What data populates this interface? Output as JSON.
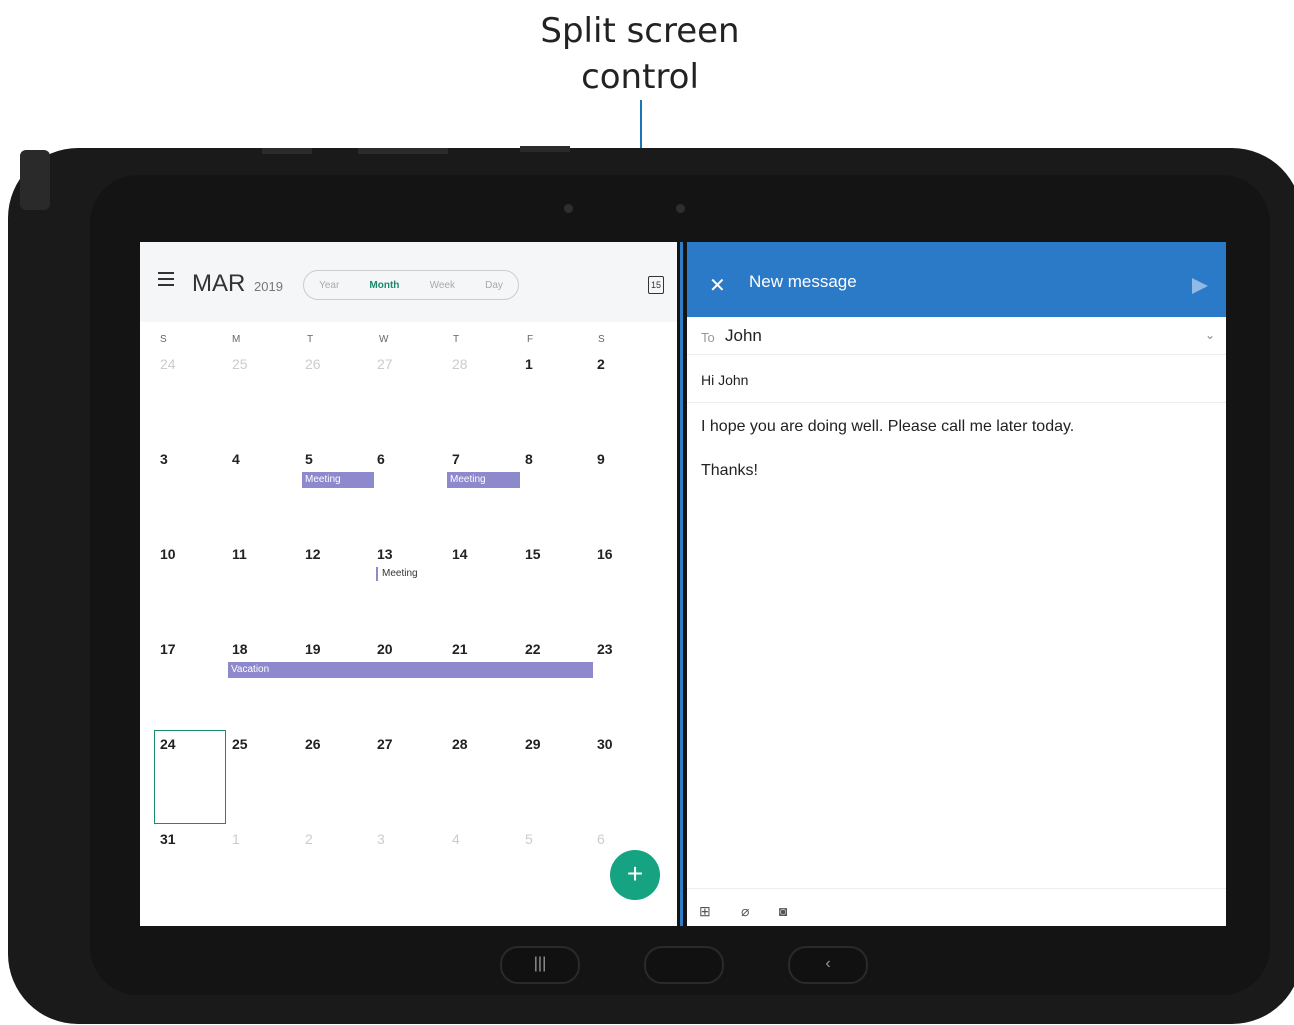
{
  "callout": {
    "line1": "Split screen",
    "line2": "control"
  },
  "calendar": {
    "month": "MAR",
    "year": "2019",
    "tabs": [
      {
        "label": "Year",
        "active": false
      },
      {
        "label": "Month",
        "active": true
      },
      {
        "label": "Week",
        "active": false
      },
      {
        "label": "Day",
        "active": false
      }
    ],
    "today_icon": "15",
    "weekdays": [
      "S",
      "M",
      "T",
      "W",
      "T",
      "F",
      "S"
    ],
    "weeks": [
      [
        "24",
        "25",
        "26",
        "27",
        "28",
        "1",
        "2"
      ],
      [
        "3",
        "4",
        "5",
        "6",
        "7",
        "8",
        "9"
      ],
      [
        "10",
        "11",
        "12",
        "13",
        "14",
        "15",
        "16"
      ],
      [
        "17",
        "18",
        "19",
        "20",
        "21",
        "22",
        "23"
      ],
      [
        "24",
        "25",
        "26",
        "27",
        "28",
        "29",
        "30"
      ],
      [
        "31",
        "1",
        "2",
        "3",
        "4",
        "5",
        "6"
      ]
    ],
    "events": {
      "meeting_5": "Meeting",
      "meeting_7": "Meeting",
      "meeting_13": "Meeting",
      "vacation": "Vacation"
    },
    "fab_label": "+"
  },
  "mail": {
    "title": "New message",
    "to_label": "To",
    "to_value": "John",
    "subject": "Hi John",
    "body_line1": "I hope you are doing well. Please call me later today.",
    "body_line2": "Thanks!"
  },
  "icons": {
    "close": "close-icon",
    "send": "send-icon",
    "menu": "menu-icon",
    "attach": "paperclip-icon",
    "camera": "camera-icon",
    "insert": "insert-icon"
  },
  "colors": {
    "accent_blue": "#2b7ac8",
    "accent_green": "#15a382",
    "event_purple": "#8e88cc"
  }
}
